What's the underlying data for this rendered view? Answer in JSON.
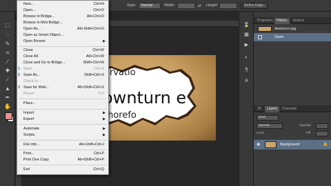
{
  "options_bar": {
    "style_label": "Style:",
    "style_value": "Normal",
    "width_label": "Width:",
    "height_label": "Height:",
    "refine_edge": "Refine Edge..."
  },
  "file_menu": {
    "items": [
      {
        "label": "New...",
        "shortcut": "Ctrl+N",
        "disabled": false
      },
      {
        "label": "Open...",
        "shortcut": "Ctrl+O",
        "disabled": false
      },
      {
        "label": "Browse in Bridge...",
        "shortcut": "Alt+Ctrl+O",
        "disabled": false
      },
      {
        "label": "Browse in Mini Bridge...",
        "shortcut": "",
        "disabled": false
      },
      {
        "label": "Open As...",
        "shortcut": "Alt+Shift+Ctrl+O",
        "disabled": false
      },
      {
        "label": "Open as Smart Object...",
        "shortcut": "",
        "disabled": false
      },
      {
        "label": "Open Recent",
        "shortcut": "",
        "submenu": true,
        "disabled": false
      },
      {
        "label": "Close",
        "shortcut": "Ctrl+W",
        "disabled": false
      },
      {
        "label": "Close All",
        "shortcut": "Alt+Ctrl+W",
        "disabled": false
      },
      {
        "label": "Close and Go to Bridge...",
        "shortcut": "Shift+Ctrl+W",
        "disabled": false
      },
      {
        "label": "Save",
        "shortcut": "Ctrl+S",
        "disabled": true
      },
      {
        "label": "Save As...",
        "shortcut": "Shift+Ctrl+S",
        "disabled": false
      },
      {
        "label": "Check In...",
        "shortcut": "",
        "disabled": true
      },
      {
        "label": "Save for Web...",
        "shortcut": "Alt+Shift+Ctrl+S",
        "disabled": false
      },
      {
        "label": "Revert",
        "shortcut": "F12",
        "disabled": true
      },
      {
        "label": "Place...",
        "shortcut": "",
        "disabled": false
      },
      {
        "label": "Import",
        "shortcut": "",
        "submenu": true,
        "disabled": false
      },
      {
        "label": "Export",
        "shortcut": "",
        "submenu": true,
        "disabled": false
      },
      {
        "label": "Automate",
        "shortcut": "",
        "submenu": true,
        "disabled": false
      },
      {
        "label": "Scripts",
        "shortcut": "",
        "submenu": true,
        "disabled": false
      },
      {
        "label": "File Info...",
        "shortcut": "Alt+Shift+Ctrl+I",
        "disabled": false
      },
      {
        "label": "Print...",
        "shortcut": "Ctrl+P",
        "disabled": false
      },
      {
        "label": "Print One Copy",
        "shortcut": "Alt+Shift+Ctrl+P",
        "disabled": false
      },
      {
        "label": "Exit",
        "shortcut": "Ctrl+Q",
        "disabled": false
      }
    ],
    "step_marks": [
      "1",
      "2",
      "3"
    ]
  },
  "document": {
    "text_lines": [
      "orvatio",
      "ownturn e",
      "thorefo"
    ]
  },
  "history_panel": {
    "tabs": [
      "Properties",
      "History",
      "Actions"
    ],
    "snapshot_name": "downturn.jpg",
    "state_name": "Open"
  },
  "layers_panel": {
    "tabs": [
      "3D",
      "Layers",
      "Channels"
    ],
    "filter_kind": "Kind",
    "blend_mode": "Normal",
    "opacity_label": "Opacity:",
    "lock_label": "Lock:",
    "fill_label": "Fill:",
    "layer_name": "Background"
  },
  "colors": {
    "foreground": "#e88c8c",
    "background": "#ffffff",
    "selection": "#5c6f86"
  }
}
